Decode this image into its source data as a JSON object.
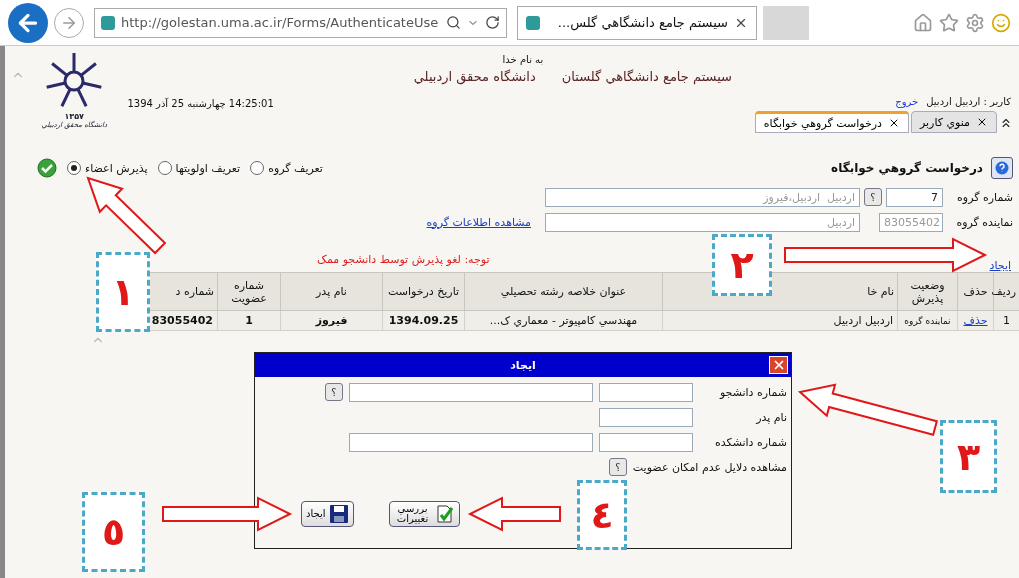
{
  "browser": {
    "address": "http://golestan.uma.ac.ir/Forms/AuthenticateUse",
    "tab_title": "سيستم جامع دانشگاهي گلس..."
  },
  "header": {
    "blessing": "به نام خدا",
    "system_title": "سيستم جامع دانشگاهي گلستان",
    "university": "دانشگاه محقق اردبيلي",
    "datetime": "14:25:01 چهارشنبه 25 آذر 1394",
    "logo": {
      "year": "۱۳۵۷",
      "caption": "دانشگاه محقق اردبيلي"
    },
    "user": "کاربر : اردبيل اردبيل",
    "logout": "خروج"
  },
  "tabs": [
    {
      "label": "منوي کاربر",
      "selected": false
    },
    {
      "label": "درخواست گروهي خوابگاه",
      "selected": true
    }
  ],
  "page_title": "درخواست گروهي خوابگاه",
  "modes": [
    {
      "label": "تعريف گروه",
      "selected": false
    },
    {
      "label": "تعريف اولويتها",
      "selected": false
    },
    {
      "label": "پذيرش اعضاء",
      "selected": true
    }
  ],
  "form": {
    "group": {
      "label": "شماره گروه",
      "value": "7",
      "help": "؟",
      "members": "اردبيل  اردبيل،فيروز"
    },
    "representative": {
      "label": "نماينده گروه",
      "value": "83055402",
      "name": "اردبيل"
    },
    "view_link": "مشاهده اطلاعات گروه"
  },
  "notice": "توجه: لغو پذيرش توسط دانشجو ممک",
  "create_link": "ايجاد",
  "table": {
    "columns": [
      {
        "label": "ردیف",
        "kind": "text"
      },
      {
        "label": "حذف",
        "kind": "link"
      },
      {
        "label": "وضعيت پذيرش",
        "kind": "small"
      },
      {
        "label": "نام خا",
        "kind": "text"
      },
      {
        "label": "عنوان خلاصه رشته تحصيلي",
        "kind": "text"
      },
      {
        "label": "تاريخ درخواست",
        "kind": "bold"
      },
      {
        "label": "نام پدر",
        "kind": "bold"
      },
      {
        "label": "شماره عضويت",
        "kind": "bold"
      },
      {
        "label": "شماره د",
        "kind": "bold"
      }
    ],
    "rows": [
      {
        "cells": [
          "1",
          "حذف",
          "نماينده گروه",
          "اردبيل اردبيل",
          "مهندسي کامپيوتر - معماري ک...",
          "1394.09.25",
          "فيروز",
          "1",
          "83055402"
        ]
      }
    ]
  },
  "dialog": {
    "title": "ايجاد",
    "fields": [
      {
        "label": "شماره دانشجو",
        "kind": "pair_help",
        "help": "؟"
      },
      {
        "label": "نام پدر",
        "kind": "single"
      },
      {
        "label": "شماره دانشکده",
        "kind": "pair"
      },
      {
        "label": "مشاهده دلايل عدم امکان عضويت",
        "kind": "help",
        "help": "؟"
      }
    ],
    "buttons": [
      {
        "label": "بررسي تغييرات",
        "kind": "check"
      },
      {
        "label": "ايجاد",
        "kind": "save"
      }
    ]
  },
  "callouts": [
    {
      "number": "١"
    },
    {
      "number": "٢"
    },
    {
      "number": "٣"
    },
    {
      "number": "٤"
    },
    {
      "number": "٥"
    }
  ]
}
